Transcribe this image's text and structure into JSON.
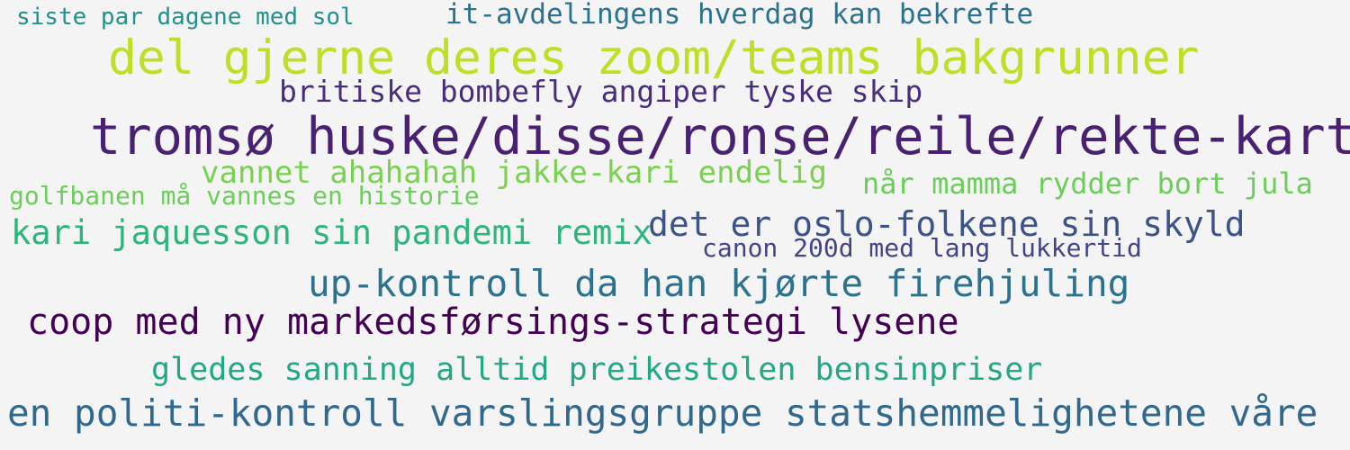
{
  "phrases": [
    {
      "text": "siste par dagene med sol",
      "color": "#21918c"
    },
    {
      "text": "it-avdelingens hverdag kan bekrefte",
      "color": "#2c728e"
    },
    {
      "text": "del gjerne deres zoom/teams bakgrunner",
      "color": "#bddf26"
    },
    {
      "text": "britiske bombefly angiper tyske skip",
      "color": "#472d7b"
    },
    {
      "text": "tromsø huske/disse/ronse/reile/rekte-kart",
      "color": "#482173"
    },
    {
      "text": "vannet ahahahah jakke-kari endelig",
      "color": "#7ad151"
    },
    {
      "text": "golfbanen må vannes en historie",
      "color": "#6ccd5a"
    },
    {
      "text": "når mamma rydder bort jula",
      "color": "#6ccd5a"
    },
    {
      "text": "kari jaquesson sin pandemi remix",
      "color": "#2fb47c"
    },
    {
      "text": "det er oslo-folkene sin skyld",
      "color": "#3b528b"
    },
    {
      "text": "canon 200d med lang lukkertid",
      "color": "#414487"
    },
    {
      "text": "up-kontroll da han kjørte firehjuling",
      "color": "#2c728e"
    },
    {
      "text": "coop med ny markedsførsings-strategi lysene",
      "color": "#440154"
    },
    {
      "text": "gledes sanning alltid preikestolen bensinpriser",
      "color": "#22a884"
    },
    {
      "text": "en politi-kontroll varslingsgruppe statshemmelighetene våre",
      "color": "#31688e"
    }
  ]
}
